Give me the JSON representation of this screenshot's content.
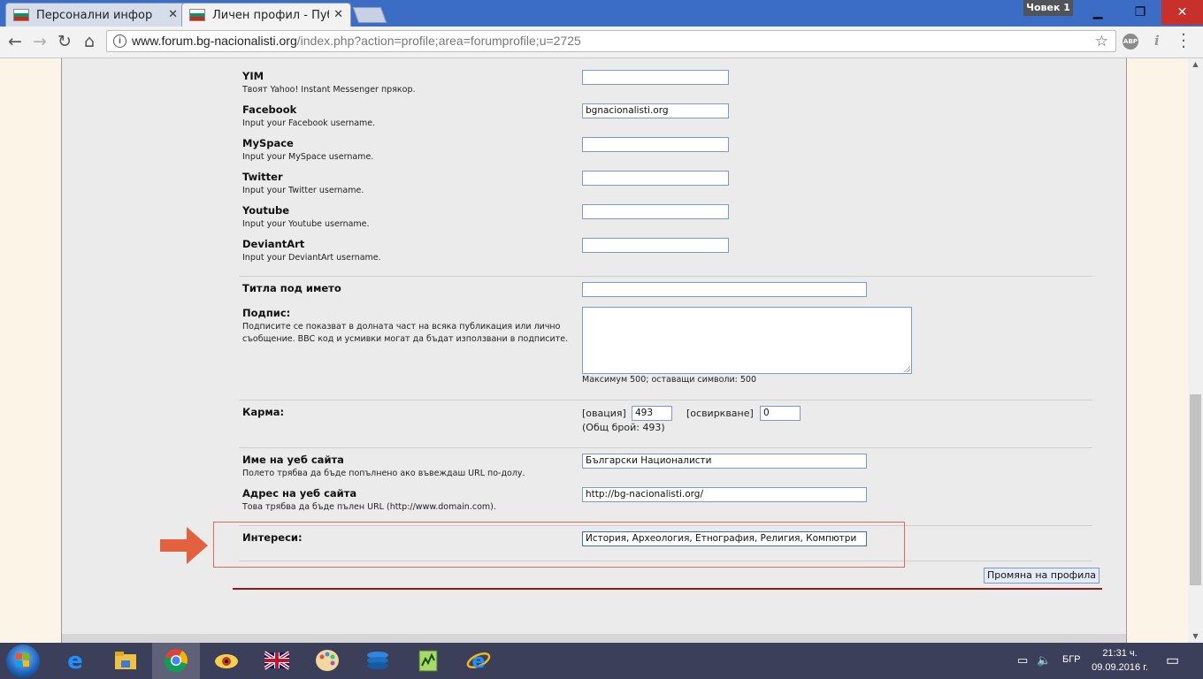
{
  "browser": {
    "tabs": [
      {
        "title": "Персонални информаци",
        "active": false
      },
      {
        "title": "Личен профил - Публич",
        "active": true
      }
    ],
    "user_badge": "Човек 1",
    "url_host": "www.forum.bg-nacionalisti.org",
    "url_path": "/index.php?action=profile;area=forumprofile;u=2725",
    "extension_abp": "ABP"
  },
  "profile": {
    "fields": [
      {
        "label": "YIM",
        "desc": "Твоят Yahoo! Instant Messenger прякор.",
        "value": ""
      },
      {
        "label": "Facebook",
        "desc": "Input your Facebook username.",
        "value": "bgnacionalisti.org"
      },
      {
        "label": "MySpace",
        "desc": "Input your MySpace username.",
        "value": ""
      },
      {
        "label": "Twitter",
        "desc": "Input your Twitter username.",
        "value": ""
      },
      {
        "label": "Youtube",
        "desc": "Input your Youtube username.",
        "value": ""
      },
      {
        "label": "DeviantArt",
        "desc": "Input your DeviantArt username.",
        "value": ""
      }
    ],
    "title_under_name": {
      "label": "Титла под името",
      "value": ""
    },
    "signature": {
      "label": "Подпис:",
      "desc_line1": "Подписите се показват в долната част на всяка публикация или лично",
      "desc_line2": "съобщение. BBC код и усмивки могат да бъдат използвани в подписите.",
      "value": "",
      "limit_text": "Максимум 500; оставащи символи: 500"
    },
    "karma": {
      "label": "Карма:",
      "applause_label": "[овация]",
      "applause_value": "493",
      "boo_label": "[освиркване]",
      "boo_value": "0",
      "total_text": "(Общ брой: 493)"
    },
    "website_name": {
      "label": "Име на уеб сайта",
      "desc": "Полето трябва да бъде попълнено ако въвеждаш URL по-долу.",
      "value": "Български Националисти"
    },
    "website_url": {
      "label": "Адрес на уеб сайта",
      "desc": "Това трябва да бъде пълен URL (http://www.domain.com).",
      "value": "http://bg-nacionalisti.org/"
    },
    "interests": {
      "label": "Интереси:",
      "value": "История, Археология, Етнография, Религия, Компютри"
    },
    "submit_label": "Промяна на профила"
  },
  "taskbar": {
    "language": "БГР",
    "time": "21:31 ч.",
    "date": "09.09.2016 г."
  },
  "colors": {
    "highlight": "#e06a5a",
    "arrow": "#e2613f",
    "accent_line": "#8b1a1a",
    "close_button": "#c7302b"
  }
}
